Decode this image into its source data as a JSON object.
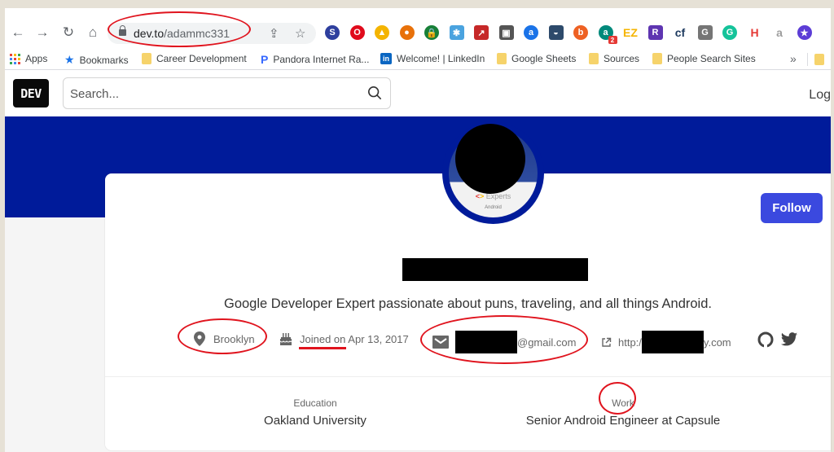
{
  "browser": {
    "nav": {
      "back_icon": "arrow-left-icon",
      "forward_icon": "arrow-right-icon",
      "reload_icon": "reload-icon",
      "home_icon": "home-icon"
    },
    "url_host": "dev.to",
    "url_path": "/adammc331",
    "omnibox_icons": [
      "share-icon",
      "bookmark-star-icon"
    ],
    "extensions": [
      {
        "name": "simplenote",
        "glyph": "S",
        "color": "#2e3f9e"
      },
      {
        "name": "opera",
        "glyph": "O",
        "color": "#e00b1c"
      },
      {
        "name": "google-drive",
        "glyph": "▲",
        "color": "#f4b400"
      },
      {
        "name": "chrome-ext",
        "glyph": "●",
        "color": "#e8710a"
      },
      {
        "name": "lock-ext",
        "glyph": "🔒",
        "color": "#188038"
      },
      {
        "name": "paint-ext",
        "glyph": "✱",
        "color": "#4aa3df"
      },
      {
        "name": "arrow-ext",
        "glyph": "↗",
        "color": "#c62828"
      },
      {
        "name": "screen-ext",
        "glyph": "▣",
        "color": "#555555"
      },
      {
        "name": "amazon-assistant",
        "glyph": "a",
        "color": "#1a73e8"
      },
      {
        "name": "window-ext",
        "glyph": "◒",
        "color": "#2d4a6b"
      },
      {
        "name": "bitly",
        "glyph": "b",
        "color": "#ee6123"
      },
      {
        "name": "a-ext",
        "glyph": "a",
        "color": "#00897b",
        "badge": "2"
      },
      {
        "name": "ez-ext",
        "glyph": "EZ",
        "color": "#f5b400"
      },
      {
        "name": "r-ext",
        "glyph": "R",
        "color": "#5e35b1"
      },
      {
        "name": "cf-ext",
        "glyph": "cf",
        "color": "#1e3a5f"
      },
      {
        "name": "g-ext",
        "glyph": "G",
        "color": "#757575"
      },
      {
        "name": "grammarly",
        "glyph": "G",
        "color": "#15c39a"
      },
      {
        "name": "h-ext",
        "glyph": "H",
        "color": "#e53935"
      },
      {
        "name": "a-gray-ext",
        "glyph": "a",
        "color": "#9e9e9e"
      },
      {
        "name": "star-ext",
        "glyph": "★",
        "color": "#5c3dd6"
      }
    ],
    "bookmarks": [
      {
        "label": "Apps",
        "icon": "apps-grid-icon"
      },
      {
        "label": "Bookmarks",
        "icon": "star-icon"
      },
      {
        "label": "Career Development",
        "icon": "folder-icon"
      },
      {
        "label": "Pandora Internet Ra...",
        "icon": "pandora-icon"
      },
      {
        "label": "Welcome! | LinkedIn",
        "icon": "linkedin-icon"
      },
      {
        "label": "Google Sheets",
        "icon": "folder-icon"
      },
      {
        "label": "Sources",
        "icon": "folder-icon"
      },
      {
        "label": "People Search Sites",
        "icon": "folder-icon"
      }
    ],
    "bookmarks_overflow": "»"
  },
  "dev": {
    "logo": "DEV",
    "search_placeholder": "Search...",
    "login_label": "Log",
    "banner_color": "#001b9a"
  },
  "profile": {
    "avatar_label_brand": "Experts",
    "avatar_label_sub": "Android",
    "follow_label": "Follow",
    "bio": "Google Developer Expert passionate about puns, traveling, and all things Android.",
    "location": "Brooklyn",
    "joined_prefix": "Joined on",
    "joined_date": "Apr 13, 2017",
    "email_suffix": "@gmail.com",
    "website_prefix": "http:/",
    "website_suffix": "y.com",
    "social_icons": [
      "github-icon",
      "twitter-icon"
    ],
    "education_label": "Education",
    "education_value": "Oakland University",
    "work_label": "Work",
    "work_value": "Senior Android Engineer at Capsule"
  },
  "colors": {
    "accent": "#3b49df",
    "annotation": "#e0141e"
  }
}
